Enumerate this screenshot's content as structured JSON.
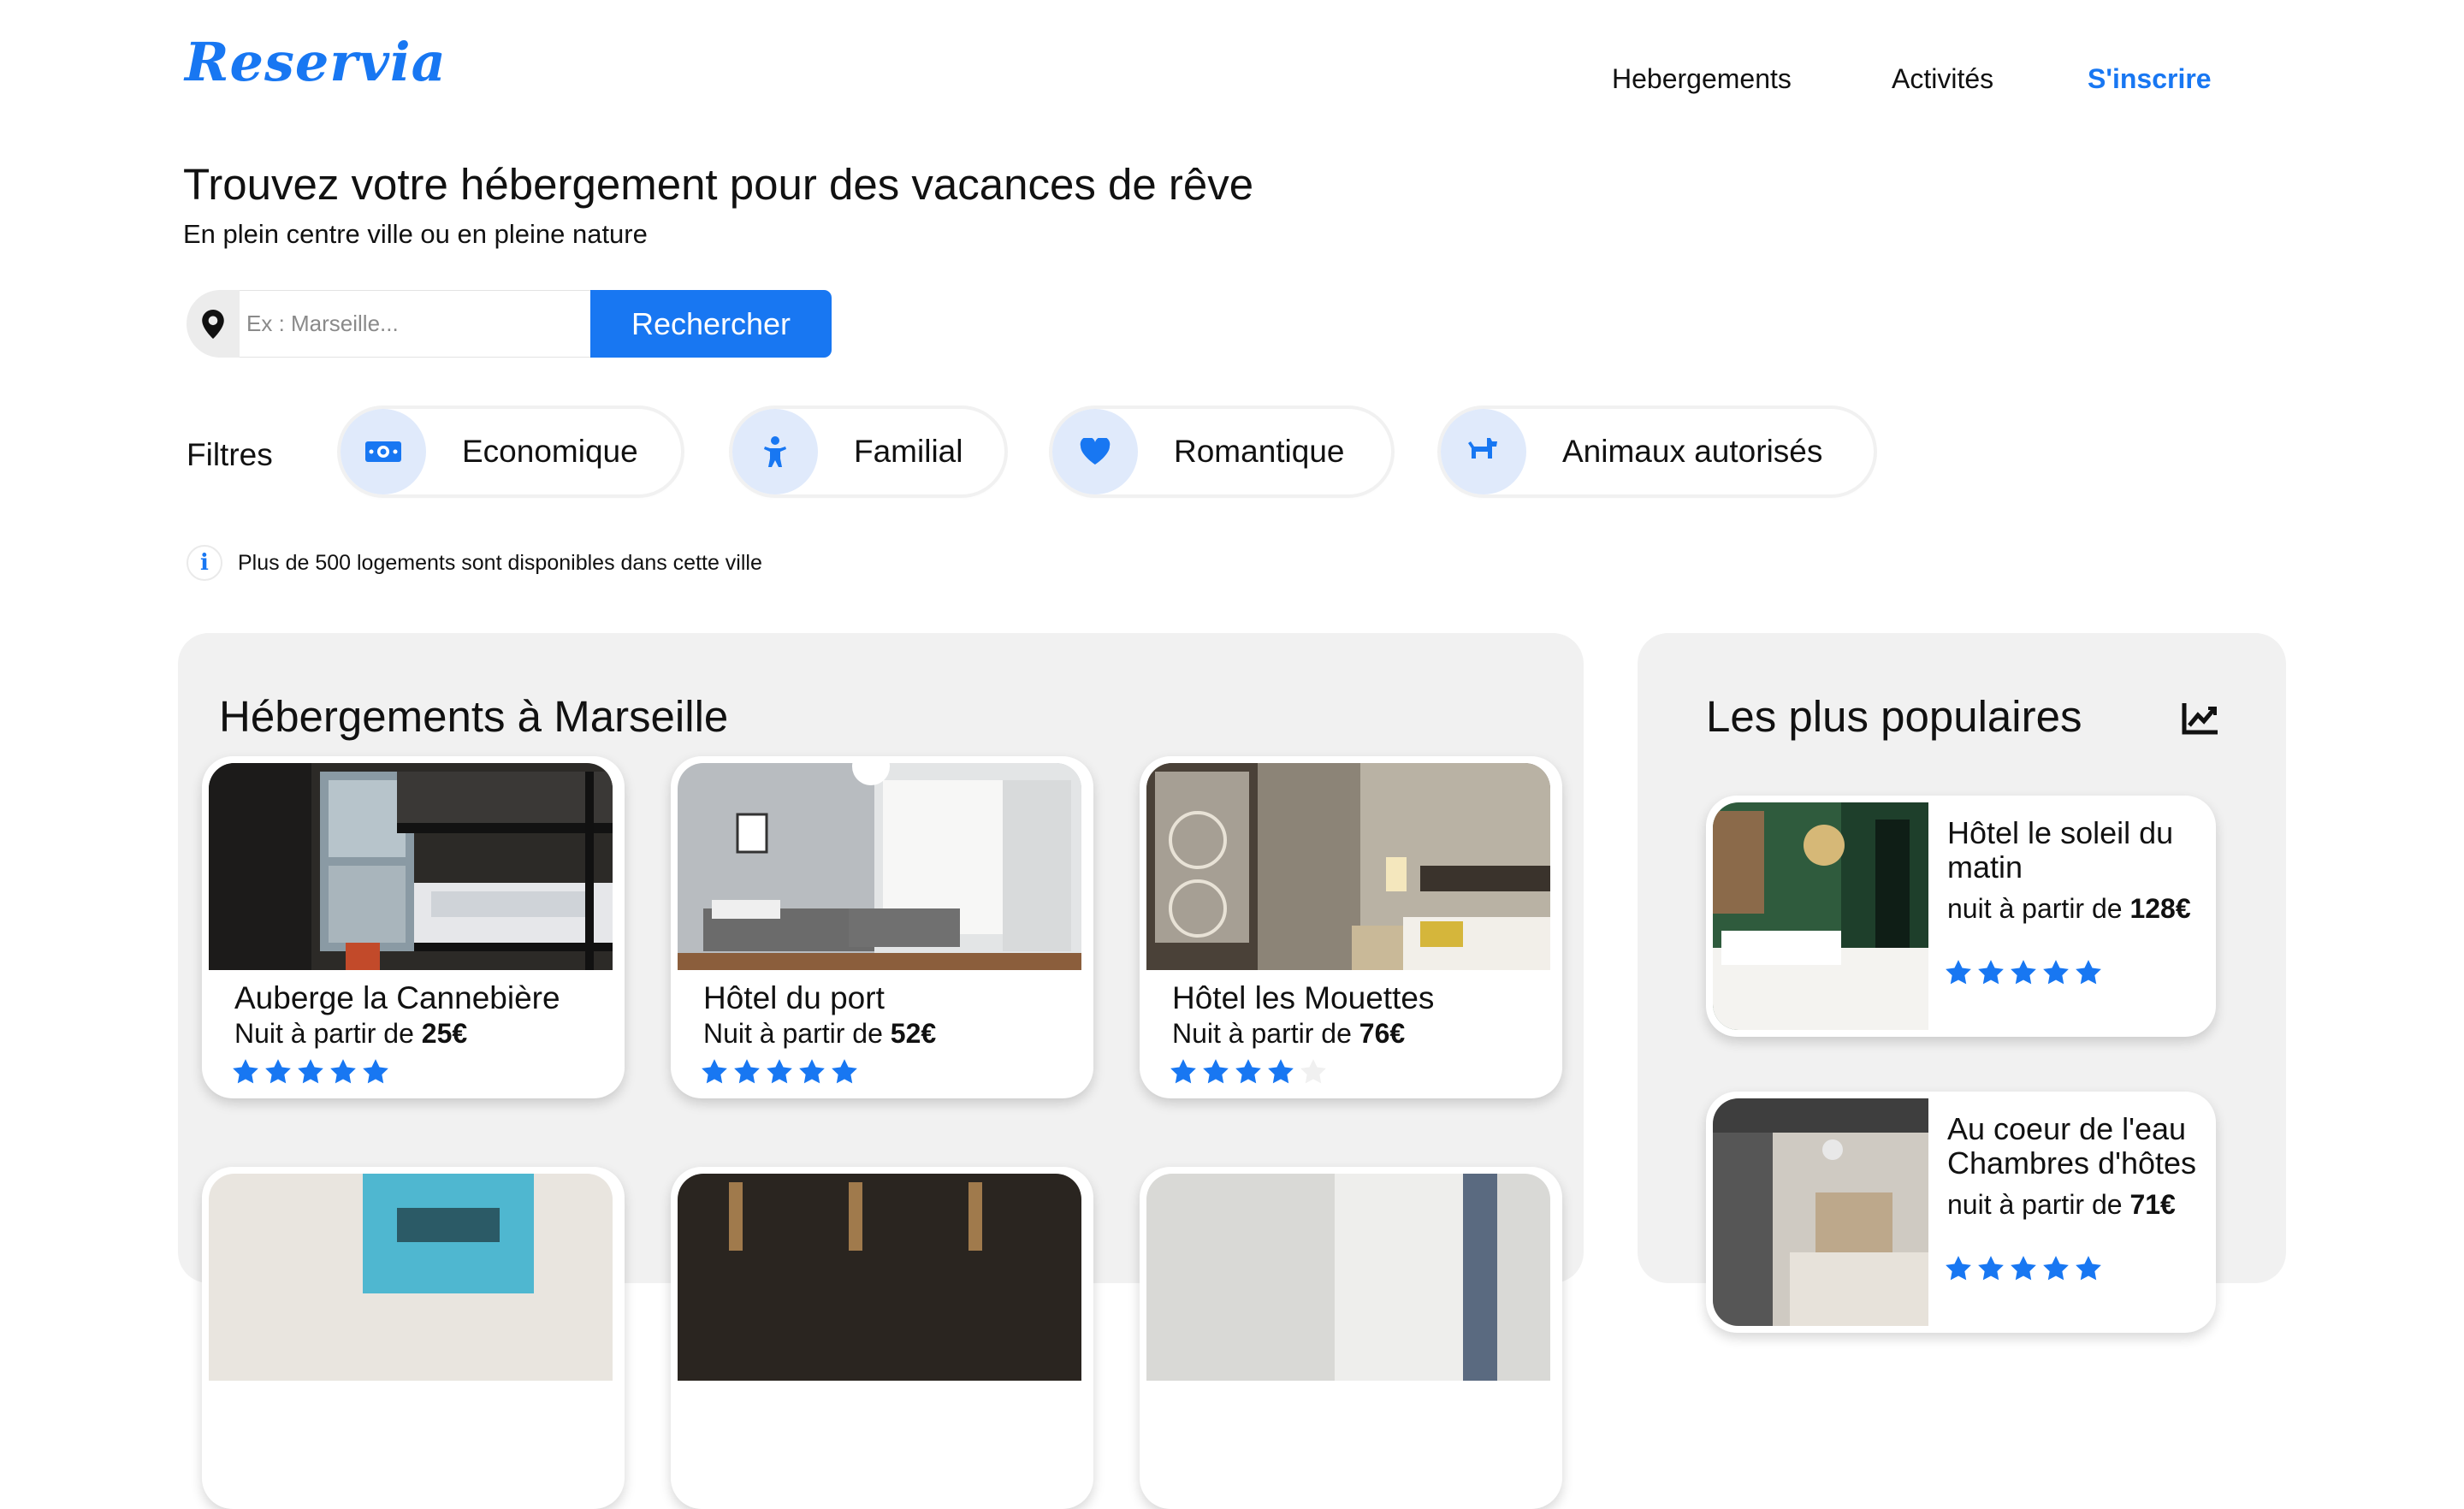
{
  "brand": {
    "logo": "Reservia"
  },
  "nav": {
    "items": [
      {
        "label": "Hebergements"
      },
      {
        "label": "Activités"
      },
      {
        "label": "S'inscrire"
      }
    ]
  },
  "hero": {
    "title": "Trouvez votre hébergement pour des vacances de rêve",
    "subtitle": "En plein centre ville ou en pleine nature"
  },
  "search": {
    "placeholder": "Ex : Marseille...",
    "value": "",
    "button_label": "Rechercher",
    "icon": "location-pin-icon"
  },
  "filters": {
    "label": "Filtres",
    "items": [
      {
        "label": "Economique",
        "icon": "money-icon"
      },
      {
        "label": "Familial",
        "icon": "child-icon"
      },
      {
        "label": "Romantique",
        "icon": "heart-icon"
      },
      {
        "label": "Animaux autorisés",
        "icon": "dog-icon"
      }
    ]
  },
  "info": {
    "icon": "info-icon",
    "text": "Plus de 500 logements sont disponibles dans cette ville"
  },
  "listings": {
    "title": "Hébergements à Marseille",
    "items": [
      {
        "name": "Auberge la Cannebière",
        "price_prefix": "Nuit à partir de ",
        "price": "25€",
        "rating": 5
      },
      {
        "name": "Hôtel du port",
        "price_prefix": "Nuit à partir de ",
        "price": "52€",
        "rating": 5
      },
      {
        "name": "Hôtel les Mouettes",
        "price_prefix": "Nuit à partir de ",
        "price": "76€",
        "rating": 4
      }
    ]
  },
  "popular": {
    "title": "Les plus populaires",
    "icon": "trend-chart-icon",
    "items": [
      {
        "name": "Hôtel le soleil du matin",
        "price_prefix": "nuit à partir de ",
        "price": "128€",
        "rating": 5
      },
      {
        "name": "Au coeur de l'eau Chambres d'hôtes",
        "price_prefix": "nuit à partir de ",
        "price": "71€",
        "rating": 5
      }
    ]
  },
  "colors": {
    "accent": "#1877f2",
    "panel": "#f1f1f1",
    "chip_icon_bg": "#e0eafb",
    "star_empty": "#f0f0f0"
  }
}
